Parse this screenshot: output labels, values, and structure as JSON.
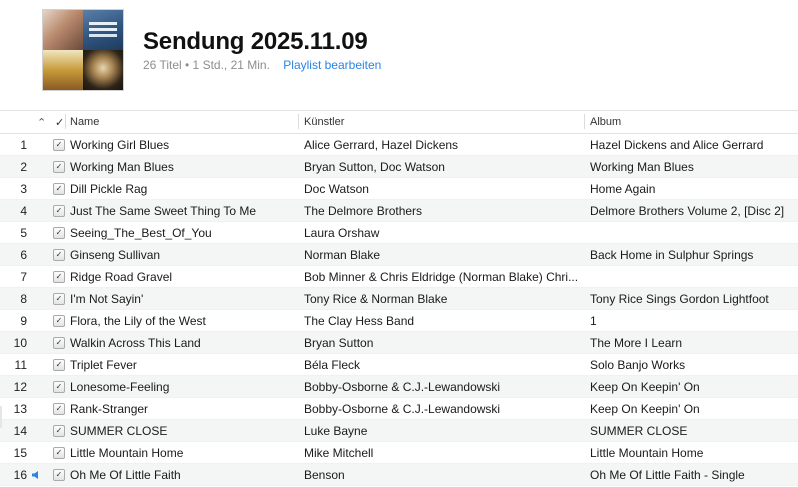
{
  "playlist": {
    "title": "Sendung 2025.11.09",
    "summary": "26 Titel • 1 Std., 21 Min.",
    "edit_label": "Playlist bearbeiten"
  },
  "columns": {
    "sort_indicator": "^",
    "check": "✓",
    "name": "Name",
    "artist": "Künstler",
    "album": "Album"
  },
  "now_playing_icon": "speaker-icon",
  "accent_color": "#2a83e6",
  "tracks": [
    {
      "num": "1",
      "checked": true,
      "name": "Working Girl Blues",
      "artist": "Alice Gerrard, Hazel Dickens",
      "album": "Hazel Dickens and Alice Gerrard"
    },
    {
      "num": "2",
      "checked": true,
      "name": "Working Man Blues",
      "artist": "Bryan Sutton, Doc Watson",
      "album": "Working Man Blues"
    },
    {
      "num": "3",
      "checked": true,
      "name": "Dill Pickle Rag",
      "artist": "Doc Watson",
      "album": "Home Again"
    },
    {
      "num": "4",
      "checked": true,
      "name": "Just The Same Sweet Thing To Me",
      "artist": "The Delmore Brothers",
      "album": "Delmore Brothers Volume 2, [Disc 2]"
    },
    {
      "num": "5",
      "checked": true,
      "name": "Seeing_The_Best_Of_You",
      "artist": "Laura Orshaw",
      "album": ""
    },
    {
      "num": "6",
      "checked": true,
      "name": "Ginseng Sullivan",
      "artist": "Norman Blake",
      "album": "Back Home in Sulphur Springs"
    },
    {
      "num": "7",
      "checked": true,
      "name": "Ridge Road Gravel",
      "artist": "Bob Minner & Chris Eldridge (Norman Blake) Chri...",
      "album": ""
    },
    {
      "num": "8",
      "checked": true,
      "name": "I'm Not Sayin'",
      "artist": "Tony Rice & Norman Blake",
      "album": "Tony Rice Sings Gordon Lightfoot"
    },
    {
      "num": "9",
      "checked": true,
      "name": "Flora, the Lily of the West",
      "artist": "The Clay Hess Band",
      "album": "1"
    },
    {
      "num": "10",
      "checked": true,
      "name": "Walkin Across This Land",
      "artist": "Bryan Sutton",
      "album": "The More I Learn"
    },
    {
      "num": "11",
      "checked": true,
      "name": "Triplet Fever",
      "artist": "Béla Fleck",
      "album": "Solo Banjo Works"
    },
    {
      "num": "12",
      "checked": true,
      "name": "Lonesome-Feeling",
      "artist": "Bobby-Osborne & C.J.-Lewandowski",
      "album": "Keep On Keepin' On"
    },
    {
      "num": "13",
      "checked": true,
      "name": "Rank-Stranger",
      "artist": "Bobby-Osborne & C.J.-Lewandowski",
      "album": "Keep On Keepin' On"
    },
    {
      "num": "14",
      "checked": true,
      "name": "SUMMER CLOSE",
      "artist": "Luke Bayne",
      "album": "SUMMER CLOSE"
    },
    {
      "num": "15",
      "checked": true,
      "name": "Little Mountain Home",
      "artist": "Mike Mitchell",
      "album": "Little Mountain Home"
    },
    {
      "num": "16",
      "checked": true,
      "playing": true,
      "name": "Oh Me Of Little Faith",
      "artist": "Benson",
      "album": "Oh Me Of Little Faith - Single"
    }
  ]
}
